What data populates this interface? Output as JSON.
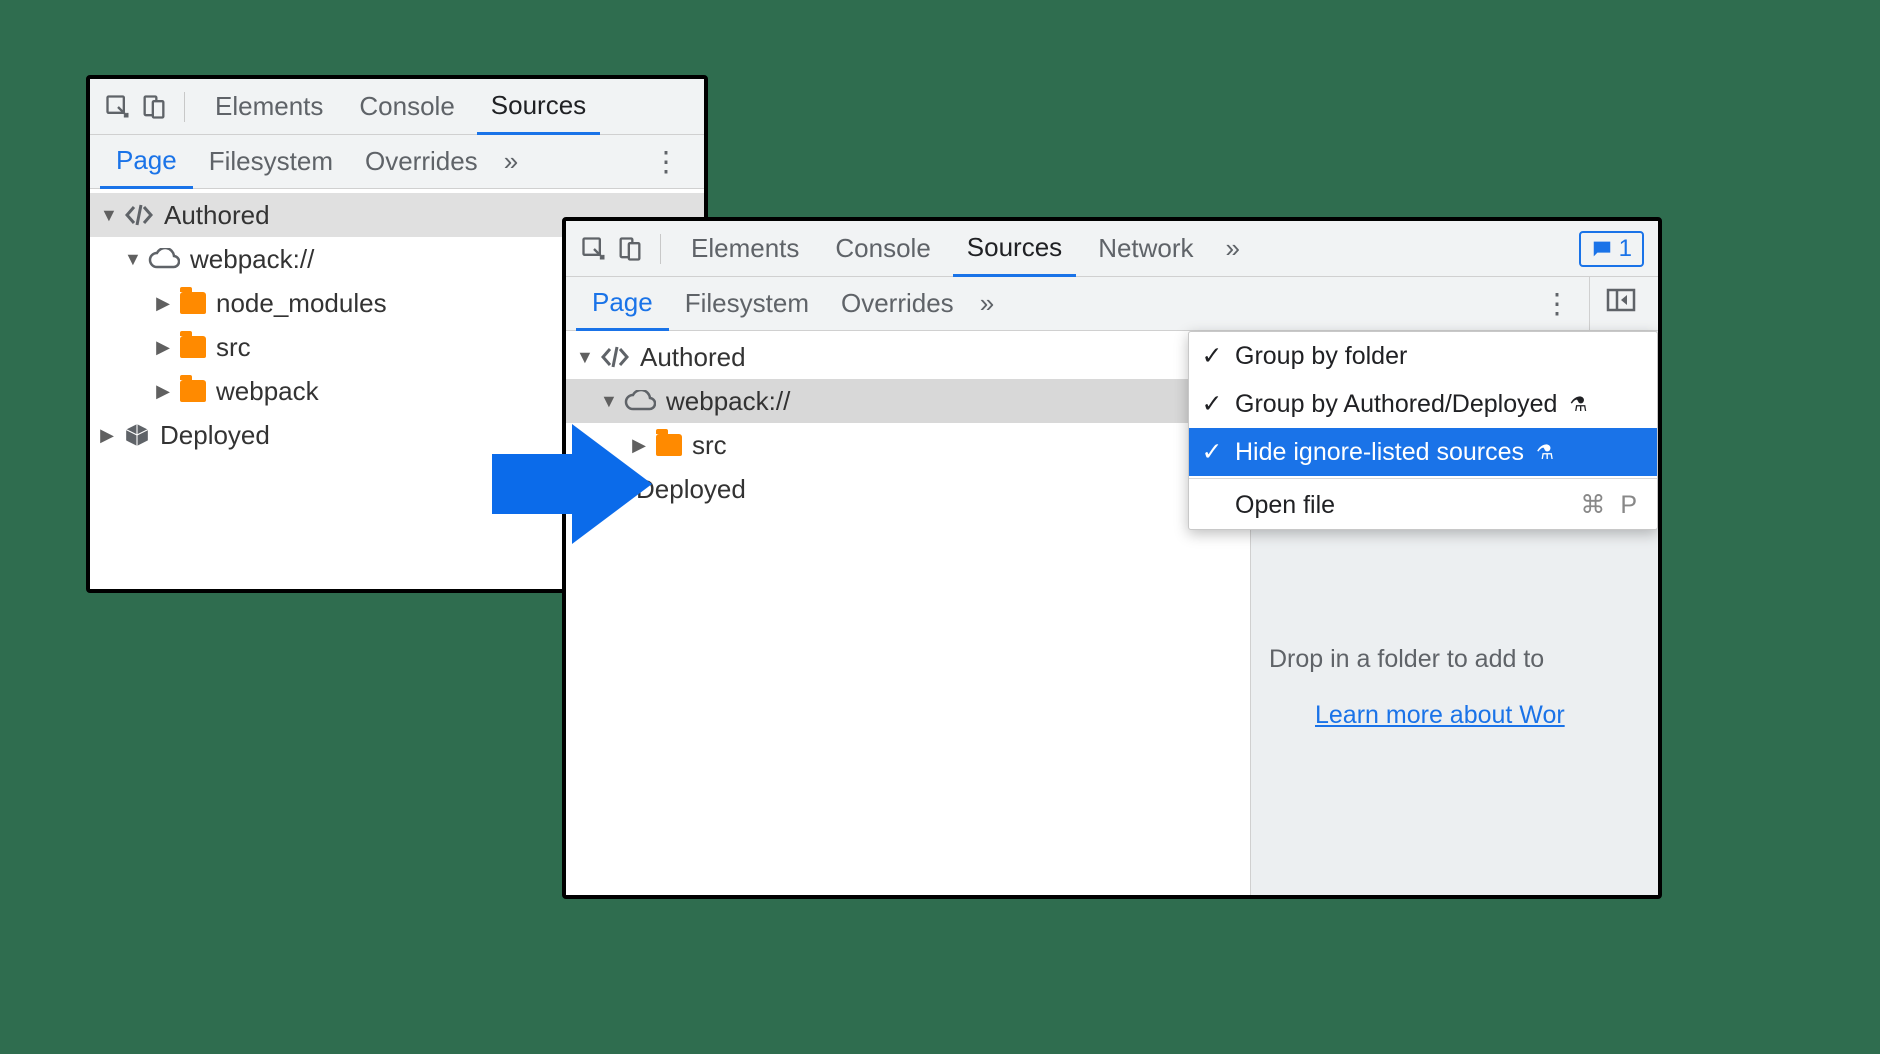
{
  "left_panel": {
    "toolbar_tabs": [
      "Elements",
      "Console",
      "Sources"
    ],
    "active_toolbar_tab": "Sources",
    "sub_tabs": [
      "Page",
      "Filesystem",
      "Overrides"
    ],
    "active_sub_tab": "Page",
    "tree": {
      "authored": "Authored",
      "webpack": "webpack://",
      "folders": [
        "node_modules",
        "src",
        "webpack"
      ],
      "deployed": "Deployed"
    }
  },
  "right_panel": {
    "toolbar_tabs": [
      "Elements",
      "Console",
      "Sources",
      "Network"
    ],
    "active_toolbar_tab": "Sources",
    "message_count": "1",
    "sub_tabs": [
      "Page",
      "Filesystem",
      "Overrides"
    ],
    "active_sub_tab": "Page",
    "tree": {
      "authored": "Authored",
      "webpack": "webpack://",
      "folders": [
        "src"
      ],
      "deployed": "Deployed"
    },
    "menu": {
      "group_by_folder": "Group by folder",
      "group_by_authored": "Group by Authored/Deployed",
      "hide_ignore_listed": "Hide ignore-listed sources",
      "open_file": "Open file",
      "open_file_shortcut": "⌘ P"
    },
    "info": {
      "drop_text": "Drop in a folder to add to",
      "learn_more": "Learn more about Wor"
    }
  }
}
